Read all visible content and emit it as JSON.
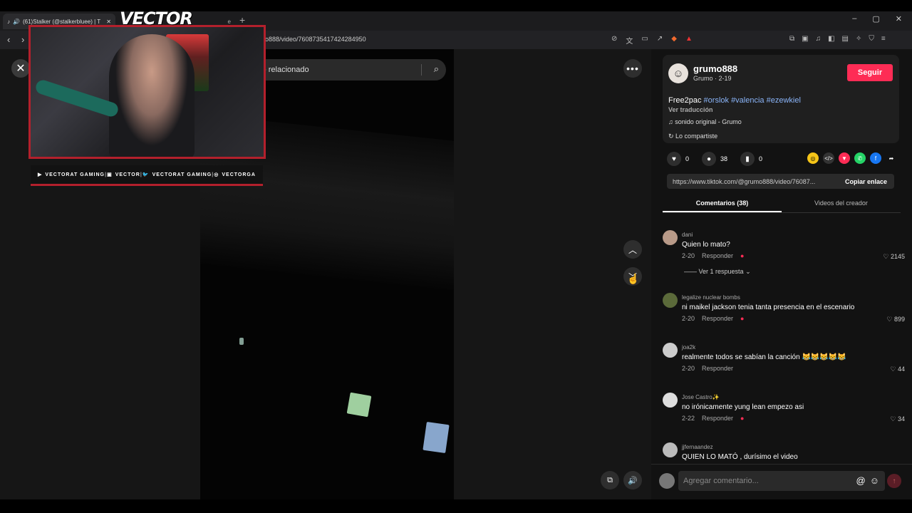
{
  "browser": {
    "tab_title": "(61)Stalker (@stalkerbluee) | T",
    "tab2_title": "e",
    "new_tab": "+",
    "url": "o888/video/7608735417424284950",
    "window_controls": [
      "–",
      "▢",
      "✕"
    ]
  },
  "overlay": {
    "logo": "VECTOR",
    "social": [
      {
        "icon": "youtube-icon",
        "label": "VECTORAT GAMING"
      },
      {
        "icon": "twitch-icon",
        "label": "VECTOR"
      },
      {
        "icon": "twitter-icon",
        "label": "VECTORAT GAMING"
      },
      {
        "icon": "instagram-icon",
        "label": "VECTORGA"
      }
    ]
  },
  "player": {
    "search_text": "ido relacionado"
  },
  "creator": {
    "username": "grumo888",
    "meta": "Grumo · 2-19",
    "follow_label": "Seguir",
    "description_prefix": "Free2pac",
    "hashtags": "#orslok #valencia #ezewkiel",
    "translate": "Ver traducción",
    "sound": "sonido original - Grumo",
    "shared": "Lo compartiste"
  },
  "stats": {
    "likes": "0",
    "comments": "38",
    "saves": "0"
  },
  "link": {
    "url": "https://www.tiktok.com/@grumo888/video/76087...",
    "copy_label": "Copiar enlace"
  },
  "tabs": {
    "comments": "Comentarios (38)",
    "creator_videos": "Videos del creador"
  },
  "comments": [
    {
      "user": "dani",
      "text": "Quien lo mato?",
      "date": "2-20",
      "reply": "Responder",
      "likes": "2145",
      "replies": "Ver 1 respuesta"
    },
    {
      "user": "legalize nuclear bombs",
      "text": "ni maikel jackson tenia tanta presencia en el escenario",
      "date": "2-20",
      "reply": "Responder",
      "likes": "899"
    },
    {
      "user": "joa2k",
      "text": "realmente todos se sabían la canción 😹😹😹😹😹",
      "date": "2-20",
      "reply": "Responder",
      "likes": "44"
    },
    {
      "user": "Jose Castro✨",
      "text": "no irónicamente yung lean empezo asi",
      "date": "2-22",
      "reply": "Responder",
      "likes": "34"
    },
    {
      "user": "jjfernaandez",
      "text": "QUIEN LO MATÓ , durísimo el video",
      "date": "",
      "reply": "",
      "likes": ""
    }
  ],
  "compose": {
    "placeholder": "Agregar comentario..."
  },
  "colors": {
    "accent": "#fe2c55",
    "webcam_border": "#b3202c",
    "hashtag": "#8ab4f8"
  }
}
